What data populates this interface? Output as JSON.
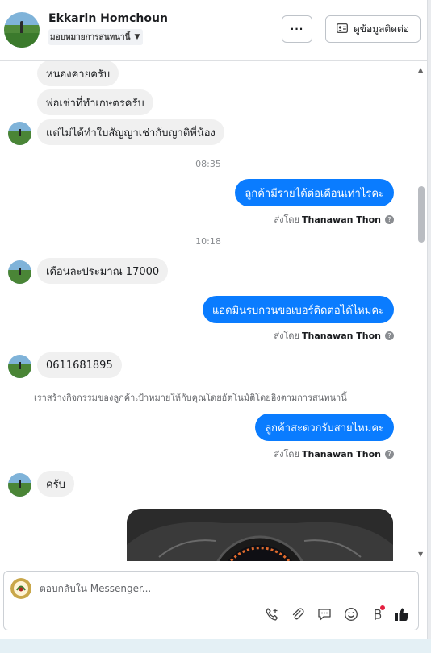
{
  "header": {
    "contact_name": "Ekkarin Homchoun",
    "assign_label": "มอบหมายการสนทนานี้",
    "more_label": "···",
    "view_contact_label": "ดูข้อมูลติดต่อ"
  },
  "messages": {
    "m1": "หนองคายครับ",
    "m2": "พ่อเช่าที่ทำเกษตรครับ",
    "m3": "แต่ไม่ได้ทำใบสัญญาเช่ากับญาติพี่น้อง",
    "time1": "08:35",
    "m4": "ลูกค้ามีรายได้ต่อเดือนเท่าไรคะ",
    "time2": "10:18",
    "m5": "เดือนละประมาณ 17000",
    "m6": "แอดมินรบกวนขอเบอร์ติดต่อได้ไหมคะ",
    "m7": "0611681895",
    "notice": "เราสร้างกิจกรรมของลูกค้าเป้าหมายให้กับคุณโดยอัตโนมัติโดยอิงตามการสนทนานี้",
    "m8": "ลูกค้าสะดวกรับสายไหมคะ",
    "m9": "ครับ"
  },
  "sent_by": {
    "prefix": "ส่งโดย",
    "name": "Thanawan Thon"
  },
  "composer": {
    "placeholder": "ตอบกลับใน Messenger..."
  },
  "colors": {
    "outgoing_bubble": "#0a7cff",
    "incoming_bubble": "#f0f0f0",
    "like_icon": "#1c1e21",
    "notification_dot": "#e41e3f"
  },
  "icons": [
    "more-icon",
    "contact-card-icon",
    "call-add-icon",
    "attach-icon",
    "saved-reply-icon",
    "emoji-icon",
    "payment-icon",
    "like-icon"
  ]
}
